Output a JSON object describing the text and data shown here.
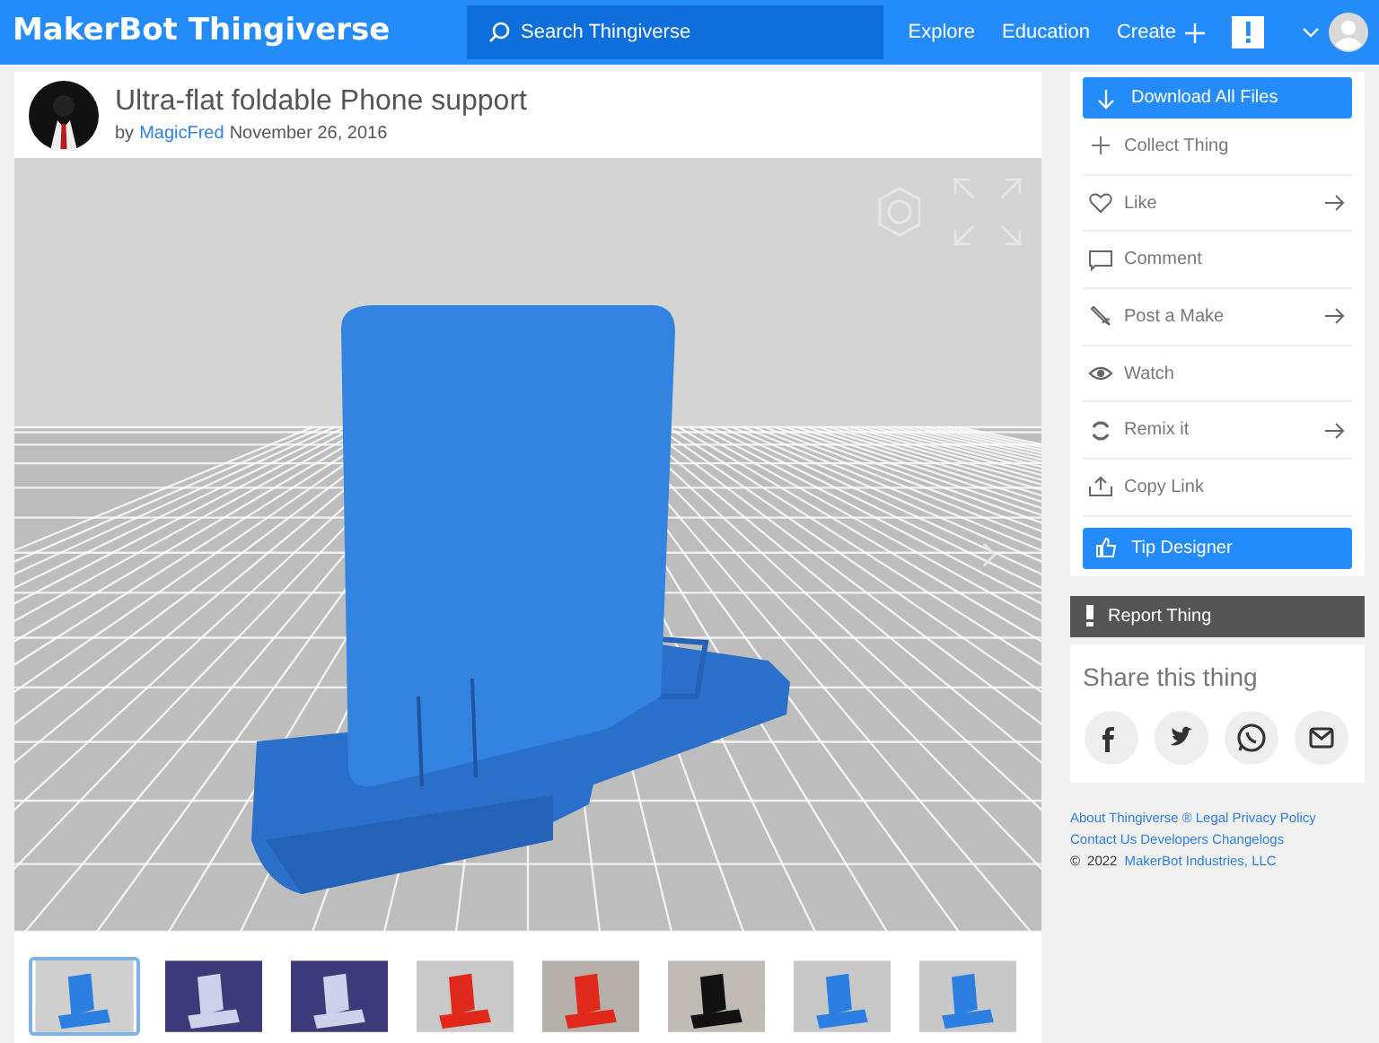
{
  "header": {
    "logo": "MakerBot",
    "logo_product": "Thingiverse",
    "search": {
      "placeholder": "Search Thingiverse"
    },
    "nav": [
      "Explore",
      "Education",
      "Create"
    ]
  },
  "thing": {
    "title": "Ultra-flat foldable Phone support",
    "by": "by",
    "author": "MagicFred",
    "date": "November 26, 2016"
  },
  "thumbnails": [
    {
      "selected": true
    },
    {
      "selected": false
    },
    {
      "selected": false
    },
    {
      "selected": false
    },
    {
      "selected": false
    },
    {
      "selected": false
    },
    {
      "selected": false
    },
    {
      "selected": false
    }
  ],
  "download_button": "Download All Files",
  "actions": [
    {
      "label": "Collect Thing",
      "arrow": false
    },
    {
      "label": "Like",
      "arrow": true
    },
    {
      "label": "Comment",
      "arrow": false
    },
    {
      "label": "Post a Make",
      "arrow": true
    },
    {
      "label": "Watch",
      "arrow": false
    },
    {
      "label": "Remix it",
      "arrow": true
    },
    {
      "label": "Copy Link",
      "arrow": false
    }
  ],
  "tip_button": "Tip Designer",
  "report_button": "Report Thing",
  "share": {
    "title": "Share this thing"
  },
  "footer": {
    "lines": [
      [
        "About Thingiverse",
        "®",
        "Legal",
        "Privacy Policy"
      ],
      [
        "Contact Us",
        "Developers",
        "Changelogs"
      ]
    ],
    "copyright": "©",
    "year": "2022",
    "company": "MakerBot Industries, LLC"
  }
}
